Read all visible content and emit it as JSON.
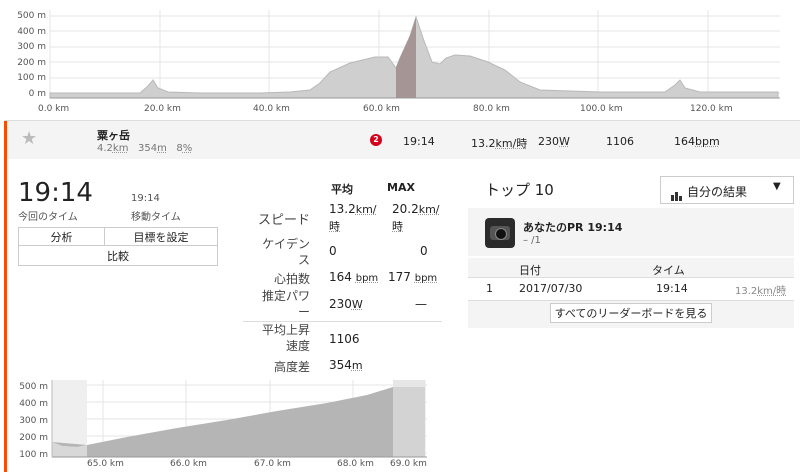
{
  "top_chart": {
    "y_ticks": [
      "500 m",
      "400 m",
      "300 m",
      "200 m",
      "100 m",
      "0 m"
    ],
    "x_ticks": [
      "0.0 km",
      "20.0 km",
      "40.0 km",
      "60.0 km",
      "80.0 km",
      "100.0 km",
      "120.0 km"
    ]
  },
  "segment": {
    "name": "粟ヶ岳",
    "distance": "4.2",
    "distance_unit": "km",
    "elev": "354",
    "elev_unit": "m",
    "grade": "8",
    "grade_unit": "%",
    "badge": "2",
    "time": "19:14",
    "speed": "13.2",
    "speed_unit": "km/時",
    "power": "230",
    "power_unit": "W",
    "vam": "1106",
    "hr": "164",
    "hr_unit": "bpm"
  },
  "summary": {
    "time": "19:14",
    "time_label": "今回のタイム",
    "moving_time": "19:14",
    "moving_time_label": "移動タイム",
    "btn_analysis": "分析",
    "btn_goal": "目標を設定",
    "btn_compare": "比較"
  },
  "stats": {
    "avg_header": "平均",
    "max_header": "MAX",
    "speed_label": "スピード",
    "speed_avg": "13.2",
    "speed_max": "20.2",
    "speed_unit": "km/時",
    "cadence_label": "ケイデンス",
    "cadence_avg": "0",
    "cadence_max": "0",
    "hr_label": "心拍数",
    "hr_avg": "164",
    "hr_max": "177",
    "hr_unit": "bpm",
    "power_label": "推定パワー",
    "power_avg": "230",
    "power_unit": "W",
    "power_max": "—",
    "vam_label": "平均上昇速度",
    "vam_avg": "1106",
    "elev_label": "高度差",
    "elev_avg": "354",
    "elev_unit": "m"
  },
  "leaderboard": {
    "title": "トップ 10",
    "dropdown": "自分の結果",
    "pr_title": "あなたのPR 19:14",
    "pr_rank": "– /1",
    "col_date": "日付",
    "col_time": "タイム",
    "rows": [
      {
        "rank": "1",
        "date": "2017/07/30",
        "time": "19:14",
        "speed": "13.2",
        "speed_unit": "km/時"
      }
    ],
    "see_all": "すべてのリーダーボードを見る"
  },
  "bottom_chart": {
    "y_ticks": [
      "500 m",
      "400 m",
      "300 m",
      "200 m",
      "100 m"
    ],
    "x_ticks": [
      "65.0 km",
      "66.0 km",
      "67.0 km",
      "68.0 km",
      "69.0 km"
    ]
  }
}
